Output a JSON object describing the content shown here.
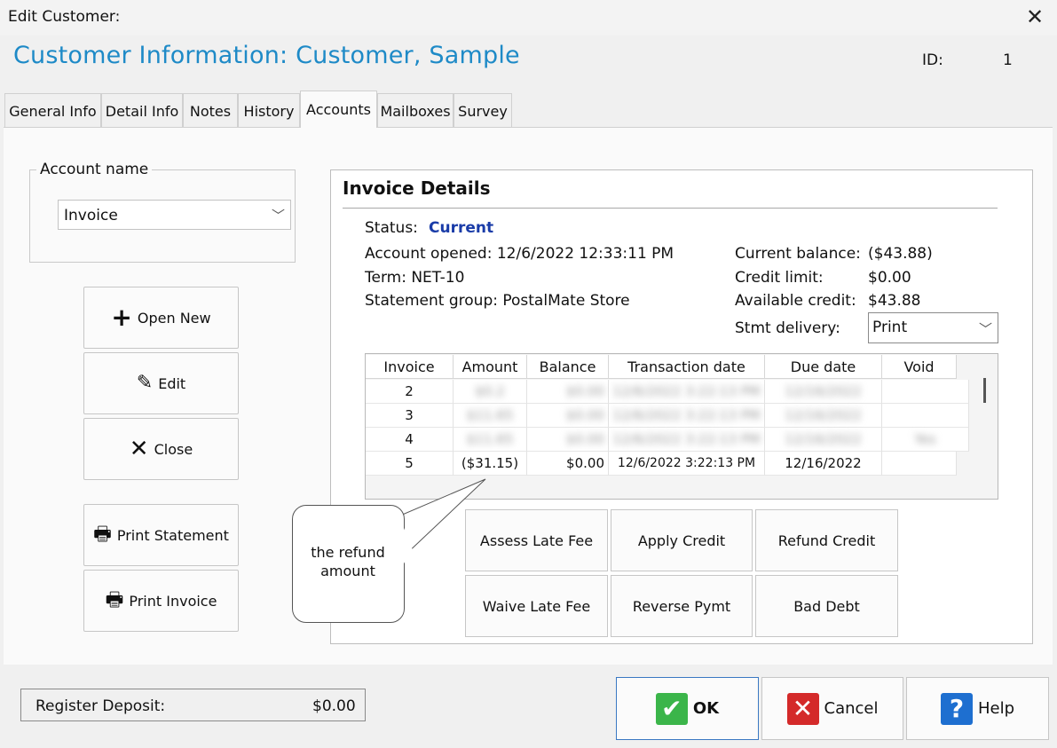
{
  "window": {
    "title": "Edit Customer:",
    "close_glyph": "✕"
  },
  "header": {
    "title": "Customer Information:  Customer, Sample",
    "id_label": "ID:",
    "id_value": "1"
  },
  "tabs": [
    {
      "label": "General Info"
    },
    {
      "label": "Detail Info"
    },
    {
      "label": "Notes"
    },
    {
      "label": "History"
    },
    {
      "label": "Accounts",
      "active": true
    },
    {
      "label": "Mailboxes"
    },
    {
      "label": "Survey"
    }
  ],
  "account": {
    "group_label": "Account name",
    "selected": "Invoice"
  },
  "side_buttons": {
    "open_new": "Open New",
    "edit": "Edit",
    "close": "Close",
    "print_statement": "Print Statement",
    "print_invoice": "Print Invoice"
  },
  "invoice_details": {
    "title": "Invoice Details",
    "status_label": "Status:",
    "status_value": "Current",
    "account_opened": "Account opened:  12/6/2022 12:33:11 PM",
    "term": "Term:  NET-10",
    "statement_group": "Statement group:  PostalMate Store",
    "current_balance_label": "Current balance:",
    "current_balance_value": "($43.88)",
    "credit_limit_label": "Credit limit:",
    "credit_limit_value": "$0.00",
    "available_credit_label": "Available credit:",
    "available_credit_value": "$43.88",
    "stmt_delivery_label": "Stmt delivery:",
    "stmt_delivery_value": "Print"
  },
  "grid": {
    "columns": [
      "Invoice",
      "Amount",
      "Balance",
      "Transaction date",
      "Due date",
      "Void"
    ],
    "rows": [
      {
        "invoice": "2",
        "amount": "$0.2",
        "balance": "$0.00",
        "date": "12/6/2022 3:22:13 PM",
        "due": "12/16/2022",
        "void": ""
      },
      {
        "invoice": "3",
        "amount": "$11.65",
        "balance": "$0.00",
        "date": "12/6/2022 3:22:13 PM",
        "due": "12/16/2022",
        "void": ""
      },
      {
        "invoice": "4",
        "amount": "$11.65",
        "balance": "$0.00",
        "date": "12/6/2022 3:22:13 PM",
        "due": "12/16/2022",
        "void": "Yes"
      },
      {
        "invoice": "5",
        "amount": "($31.15)",
        "balance": "$0.00",
        "date": "12/6/2022 3:22:13 PM",
        "due": "12/16/2022",
        "void": ""
      }
    ]
  },
  "action_buttons": {
    "assess_late_fee": "Assess Late Fee",
    "apply_credit": "Apply Credit",
    "refund_credit": "Refund Credit",
    "waive_late_fee": "Waive Late Fee",
    "reverse_pymt": "Reverse Pymt",
    "bad_debt": "Bad Debt"
  },
  "callout": {
    "line1": "the refund",
    "line2": "amount"
  },
  "footer": {
    "deposit_label": "Register Deposit:",
    "deposit_value": "$0.00",
    "ok": "OK",
    "cancel": "Cancel",
    "help": "Help"
  },
  "colors": {
    "title_blue": "#1e8ac7",
    "status_blue": "#1a3ca8",
    "ok_green": "#3bb54a",
    "cancel_red": "#d42a2a",
    "help_blue": "#1e6fd0"
  },
  "icons": [
    "plus-icon",
    "pencil-icon",
    "x-icon",
    "printer-icon",
    "check-icon",
    "cancel-x-icon",
    "help-question-icon",
    "chevron-down-icon",
    "close-icon"
  ]
}
